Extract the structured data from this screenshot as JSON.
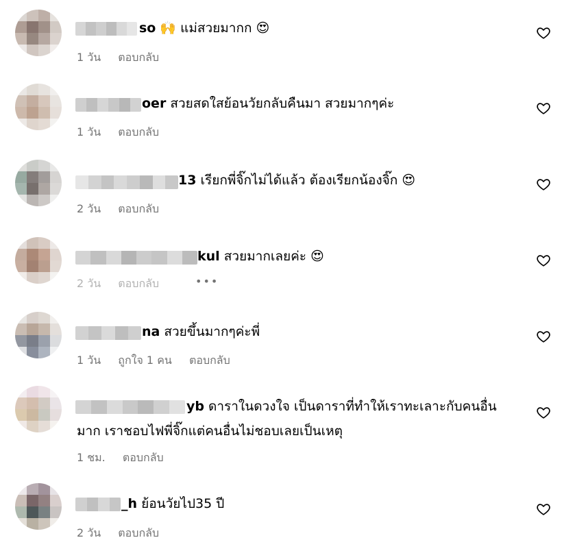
{
  "comments": [
    {
      "suffix": "so",
      "text": "🙌 แม่สวยมากก 😍",
      "time": "1 วัน",
      "likes": "",
      "reply": "ตอบกลับ"
    },
    {
      "suffix": "oer",
      "text": "สวยสดใสย้อนวัยกลับคืนมา สวยมากๆค่ะ",
      "time": "1 วัน",
      "likes": "",
      "reply": "ตอบกลับ"
    },
    {
      "suffix": "13",
      "text": "เรียกพี่จิ๊กไม่ได้แล้ว ต้องเรียกน้องจิ๊ก 😍",
      "time": "2 วัน",
      "likes": "",
      "reply": "ตอบกลับ"
    },
    {
      "suffix": "kul",
      "text": "สวยมากเลยค่ะ 😍",
      "time": "2 วัน",
      "likes": "",
      "reply": "ตอบกลับ",
      "more": "•••"
    },
    {
      "suffix": "na",
      "text": "สวยขึ้นมากๆค่ะพี่",
      "time": "1 วัน",
      "likes": "ถูกใจ 1 คน",
      "reply": "ตอบกลับ"
    },
    {
      "suffix": "yb",
      "text": "ดาราในดวงใจ เป็นดาราที่ทำให้เราทะเลาะกับคนอื่น",
      "text_line2": "มาก เราชอบไฟพี่จิ๊กแต่คนอื่นไม่ชอบเลยเป็นเหตุ",
      "time": "1 ชม.",
      "likes": "",
      "reply": "ตอบกลับ"
    },
    {
      "suffix": "_h",
      "text": "ย้อนวัยไป35 ปี",
      "time": "2 วัน",
      "likes": "",
      "reply": "ตอบกลับ"
    }
  ],
  "icons": {
    "like": "heart-outline-icon",
    "more": "ellipsis-icon"
  },
  "colors": {
    "text": "#000000",
    "meta": "#737373",
    "background": "#ffffff"
  }
}
